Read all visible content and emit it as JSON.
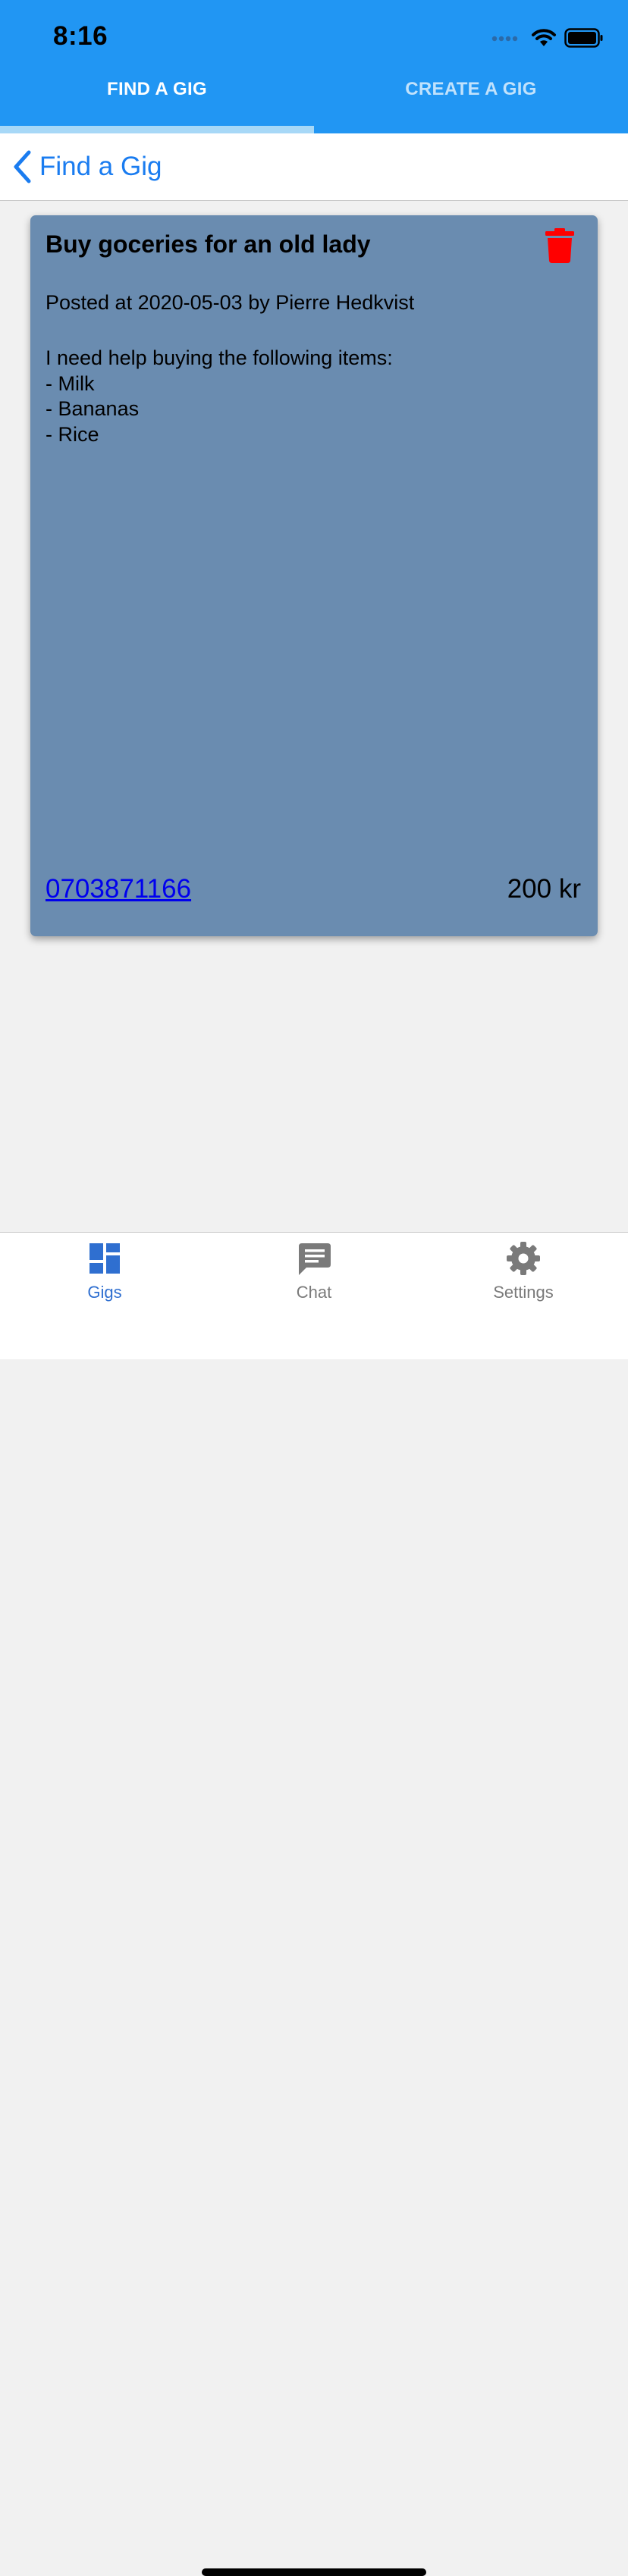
{
  "status_bar": {
    "time": "8:16"
  },
  "top_tabs": [
    {
      "label": "FIND A GIG",
      "active": true
    },
    {
      "label": "CREATE A GIG",
      "active": false
    }
  ],
  "nav": {
    "back_label": "Find a Gig"
  },
  "gig": {
    "title": "Buy goceries for an old lady",
    "meta": "Posted at 2020-05-03 by Pierre Hedkvist",
    "description_lines": [
      "I need help buying the following items:",
      "- Milk",
      "- Bananas",
      "- Rice"
    ],
    "phone": "0703871166",
    "price": "200 kr",
    "delete_icon": "trash-icon"
  },
  "bottom_tabs": [
    {
      "label": "Gigs",
      "icon": "dashboard-icon",
      "active": true
    },
    {
      "label": "Chat",
      "icon": "chat-icon",
      "active": false
    },
    {
      "label": "Settings",
      "icon": "gear-icon",
      "active": false
    }
  ],
  "colors": {
    "header": "#2196f3",
    "tab_indicator": "#a7d8f7",
    "card": "#6a8cb0",
    "link": "#0000ee",
    "back_link": "#1a7cf0",
    "delete": "#ff0000",
    "active_tab": "#2f6fd0",
    "inactive_tab": "#7a7a7a"
  }
}
